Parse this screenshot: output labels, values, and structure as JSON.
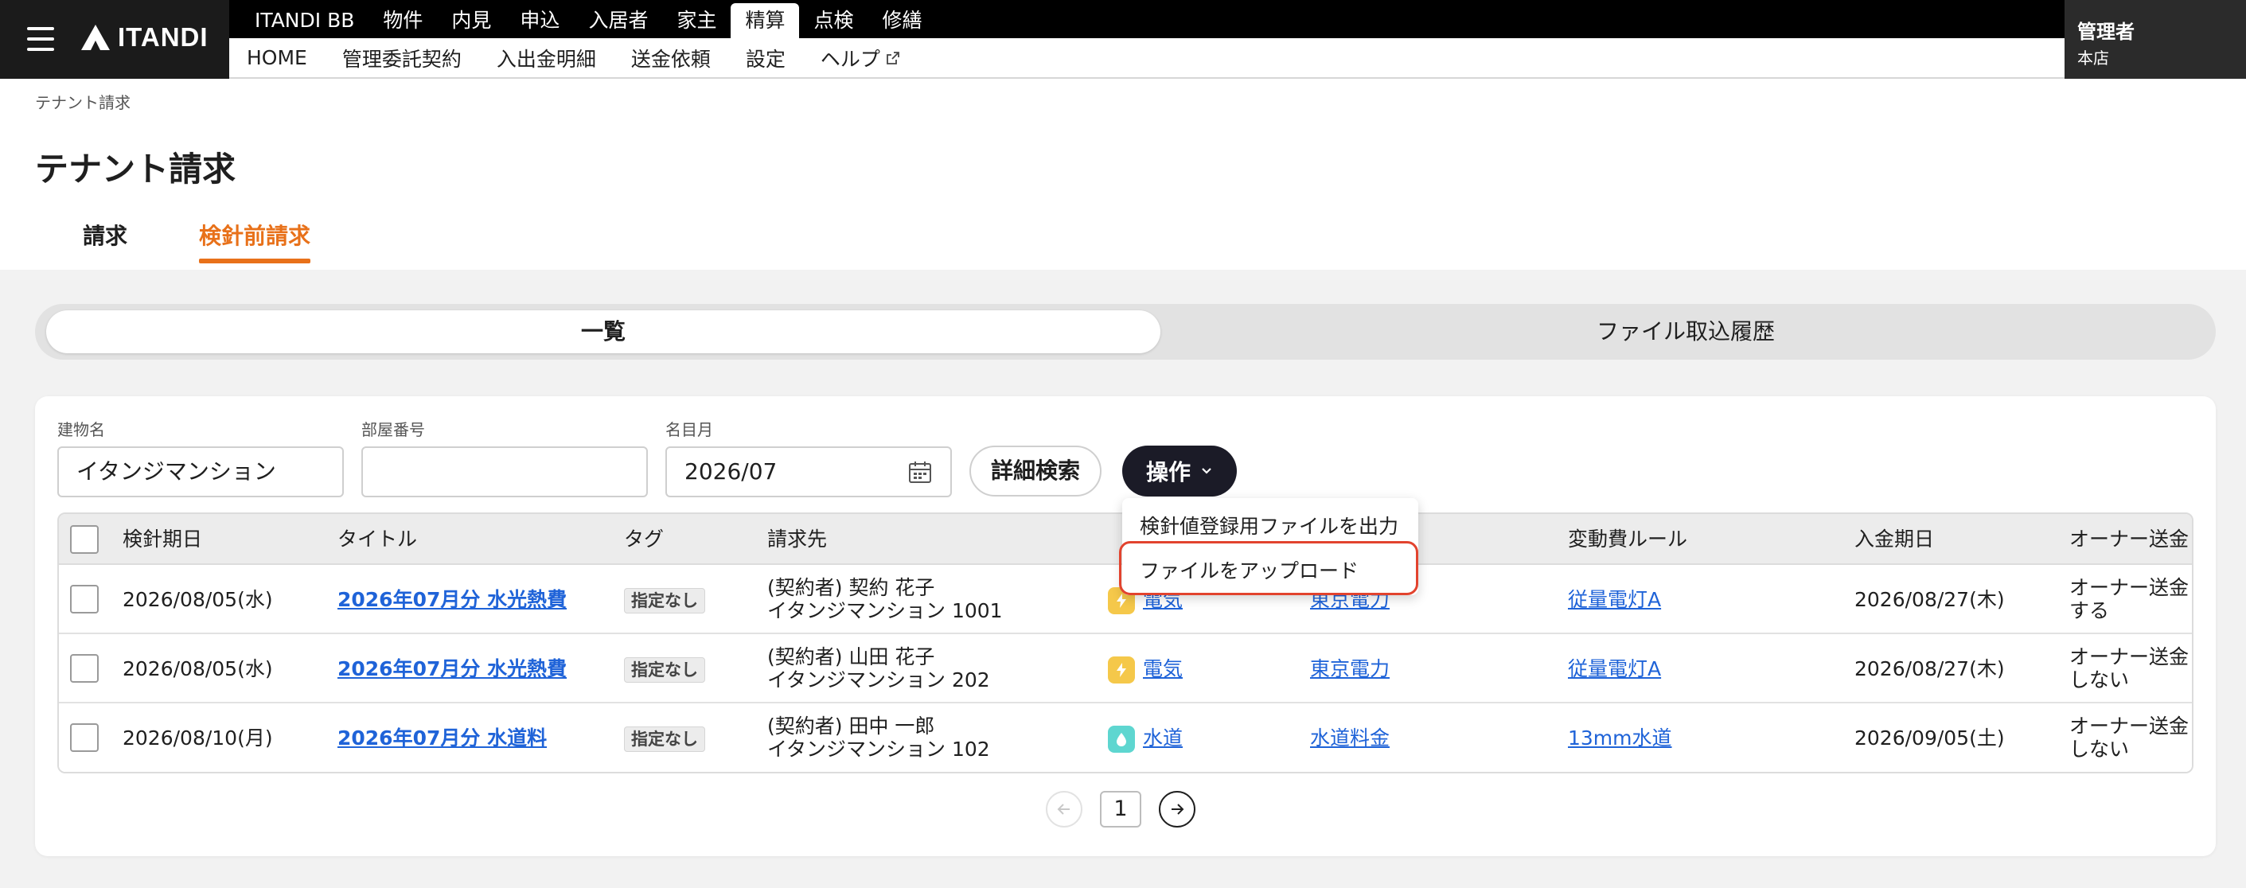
{
  "brand": {
    "logo_text": "ITANDI"
  },
  "nav": {
    "main": [
      "ITANDI BB",
      "物件",
      "内見",
      "申込",
      "入居者",
      "家主",
      "精算",
      "点検",
      "修繕"
    ],
    "active_main": "精算",
    "sub": [
      "HOME",
      "管理委託契約",
      "入出金明細",
      "送金依頼",
      "設定",
      "ヘルプ"
    ]
  },
  "user": {
    "name": "管理者",
    "branch": "本店"
  },
  "breadcrumb": "テナント請求",
  "page_title": "テナント請求",
  "tabs": [
    {
      "label": "請求",
      "active": false
    },
    {
      "label": "検針前請求",
      "active": true
    }
  ],
  "segment": {
    "active": "一覧",
    "inactive": "ファイル取込履歴"
  },
  "filters": {
    "building": {
      "label": "建物名",
      "value": "イタンジマンション"
    },
    "room": {
      "label": "部屋番号",
      "value": ""
    },
    "month": {
      "label": "名目月",
      "value": "2026/07"
    },
    "detail_search_label": "詳細検索",
    "operation_label": "操作"
  },
  "dropdown": {
    "items": [
      "検針値登録用ファイルを出力",
      "ファイルをアップロード"
    ]
  },
  "table": {
    "columns": [
      "検針期日",
      "タイトル",
      "タグ",
      "請求先",
      "",
      "",
      "変動費ルール",
      "入金期日",
      "オーナー送金"
    ],
    "rows": [
      {
        "date": "2026/08/05(水)",
        "title": "2026年07月分 水光熱費",
        "tag": "指定なし",
        "billing_line1": "(契約者) 契約 花子",
        "billing_line2": "イタンジマンション 1001",
        "utility": "電気",
        "utility_type": "electricity",
        "provider": "東京電力",
        "rule": "従量電灯A",
        "due": "2026/08/27(木)",
        "owner_line1": "オーナー送金",
        "owner_line2": "する"
      },
      {
        "date": "2026/08/05(水)",
        "title": "2026年07月分 水光熱費",
        "tag": "指定なし",
        "billing_line1": "(契約者) 山田 花子",
        "billing_line2": "イタンジマンション 202",
        "utility": "電気",
        "utility_type": "electricity",
        "provider": "東京電力",
        "rule": "従量電灯A",
        "due": "2026/08/27(木)",
        "owner_line1": "オーナー送金",
        "owner_line2": "しない"
      },
      {
        "date": "2026/08/10(月)",
        "title": "2026年07月分 水道料",
        "tag": "指定なし",
        "billing_line1": "(契約者) 田中 一郎",
        "billing_line2": "イタンジマンション 102",
        "utility": "水道",
        "utility_type": "water",
        "provider": "水道料金",
        "rule": "13mm水道",
        "due": "2026/09/05(土)",
        "owner_line1": "オーナー送金",
        "owner_line2": "しない"
      }
    ]
  },
  "pagination": {
    "current": "1"
  },
  "colors": {
    "accent": "#e8711a",
    "link": "#1f63d8",
    "highlight": "#e2432e"
  }
}
